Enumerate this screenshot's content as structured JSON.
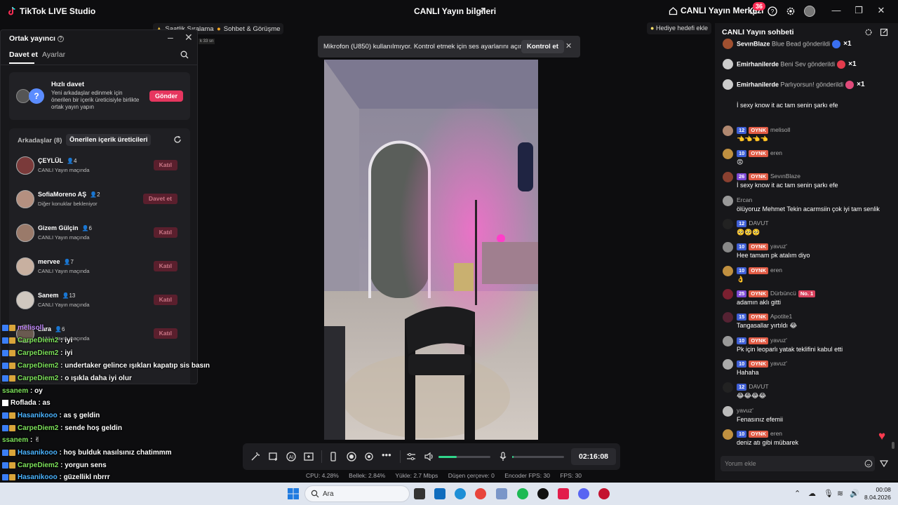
{
  "titlebar": {
    "app_title": "TikTok LIVE Studio",
    "center_title": "CANLI Yayın bilgileri",
    "live_center": "CANLI Yayın Merkezi",
    "notif_count": "36"
  },
  "chips": {
    "ranking": "Saatlik Sıralama",
    "chat_meet": "Sohbet & Görüşme",
    "gift_goal": "Hediye hedefi ekle",
    "distance": "k 33 sn"
  },
  "cohost": {
    "title": "Ortak yayıncı",
    "tab_invite": "Davet et",
    "tab_settings": "Ayarlar",
    "quick_title": "Hızlı davet",
    "quick_desc": "Yeni arkadaşlar edinmek için önerilen bir içerik üreticisiyle birlikte ortak yayın yapın",
    "quick_btn": "Gönder",
    "friends_tab": "Arkadaşlar (8)",
    "suggested_tab": "Önerilen içerik üreticileri",
    "friends": [
      {
        "name": "ÇEYLÜL",
        "count": "4",
        "status": "CANLI Yayın maçında",
        "btn": "Katıl"
      },
      {
        "name": "SofiaMoreno AŞ",
        "count": "2",
        "status": "Diğer konuklar bekleniyor",
        "btn": "Davet et"
      },
      {
        "name": "Gizem Gülçin",
        "count": "6",
        "status": "CANLI Yayın maçında",
        "btn": "Katıl"
      },
      {
        "name": "mervee",
        "count": "7",
        "status": "CANLI Yayın maçında",
        "btn": "Katıl"
      },
      {
        "name": "Sanem",
        "count": "13",
        "status": "CANLI Yayın maçında",
        "btn": "Katıl"
      },
      {
        "name": "Lara",
        "count": "6",
        "status": "CANLI Yayın maçında",
        "btn": "Katıl"
      }
    ]
  },
  "overlay_chat": [
    {
      "user": "melisoll",
      "text": "",
      "style": "purple"
    },
    {
      "user": "CarpeDiem2",
      "text": ": iyi",
      "style": "green"
    },
    {
      "user": "CarpeDiem2",
      "text": ": iyi",
      "style": "green"
    },
    {
      "user": "CarpeDiem2",
      "text": ": undertaker gelince ışıkları kapatıp sis basın",
      "style": "green"
    },
    {
      "user": "CarpeDiem2",
      "text": ": o ışıkla daha iyi olur",
      "style": "green"
    },
    {
      "user": "ssanem",
      "text": ": oy",
      "style": "plain-green"
    },
    {
      "user": "Roflada",
      "text": ": as",
      "style": "white"
    },
    {
      "user": "Hasanikooo",
      "text": ": as ş geldin",
      "style": "blue"
    },
    {
      "user": "CarpeDiem2",
      "text": ": sende hoş geldin",
      "style": "green"
    },
    {
      "user": "ssanem",
      "text": ": ✌",
      "style": "plain-green"
    },
    {
      "user": "Hasanikooo",
      "text": ": hoş bulduk nasılsınız chatimmm",
      "style": "blue"
    },
    {
      "user": "CarpeDiem2",
      "text": ": yorgun sens",
      "style": "green"
    },
    {
      "user": "Hasanikooo",
      "text": ": güzellikl nbrrr",
      "style": "blue"
    }
  ],
  "mic_toast": {
    "text": "Mikrofon (U850) kullanılmıyor. Kontrol etmek için ses ayarlarını açın.",
    "btn": "Kontrol et"
  },
  "controls": {
    "timer": "02:16:08",
    "volume_level": 0.35,
    "mic_level": 0.03
  },
  "stats": {
    "cpu": "CPU: 4.28%",
    "mem": "Bellek: 2.84%",
    "upload": "Yükle: 2.7 Mbps",
    "dropped": "Düşen çerçeve: 0",
    "encoder": "Encoder FPS: 30",
    "fps": "FPS: 30"
  },
  "right_chat": {
    "title": "CANLI Yayın sohbeti",
    "gifts": [
      {
        "user": "SevınBlaze",
        "text": "Blue Bead gönderildi",
        "mult": "×1",
        "color": "#3a6ff0"
      },
      {
        "user": "Emirhanilerde",
        "text": "Beni Sev gönderildi",
        "mult": "×1",
        "color": "#e33b4c"
      },
      {
        "user": "Emirhanilerde",
        "text": "Parlıyorsun! gönderildi",
        "mult": "×1",
        "color": "#e04a7a"
      }
    ],
    "messages": [
      {
        "level": "",
        "oynk": false,
        "user": "",
        "body": "İ sexy know it ac tam senin şarkı efe",
        "nohead": true
      },
      {
        "level": "12",
        "oynk": true,
        "user": "melisoll",
        "body": "👈👈👈👈"
      },
      {
        "level": "10",
        "oynk": true,
        "user": "eren",
        "body": "😡"
      },
      {
        "level": "26",
        "oynk": true,
        "user": "SevınBlaze",
        "body": "İ sexy know it ac tam senin şarkı efe",
        "purple": true
      },
      {
        "level": "",
        "oynk": false,
        "user": "Ercan",
        "body": "ölüyoruz Mehmet Tekin acarmsiin çok iyi tam senlik"
      },
      {
        "level": "12",
        "oynk": false,
        "user": "DAVUT",
        "body": "🥺🥺🥺"
      },
      {
        "level": "10",
        "oynk": true,
        "user": "yavuz'",
        "body": "Hee tamam pk atalım diyo"
      },
      {
        "level": "10",
        "oynk": true,
        "user": "eren",
        "body": "👌"
      },
      {
        "level": "25",
        "oynk": true,
        "user": "Dürbüncü",
        "body": "adamın aklı gitti",
        "purple": true,
        "no1": "No. 1"
      },
      {
        "level": "15",
        "oynk": true,
        "user": "Apotite1",
        "body": "Tangasallar yırtıldı 😂"
      },
      {
        "level": "10",
        "oynk": true,
        "user": "yavuz'",
        "body": "Pk için leoparlı yatak teklifini kabul etti"
      },
      {
        "level": "10",
        "oynk": true,
        "user": "yavuz'",
        "body": "Hahaha"
      },
      {
        "level": "12",
        "oynk": false,
        "user": "DAVUT",
        "body": "😂😂😂😂"
      },
      {
        "level": "",
        "oynk": false,
        "user": "yavuz'",
        "body": "Fenasınız efemii"
      },
      {
        "level": "10",
        "oynk": true,
        "user": "eren",
        "body": "deniz atı gibi mübarek"
      }
    ],
    "oynk_label": "OYNK",
    "comment_placeholder": "Yorum ekle"
  },
  "taskbar": {
    "search": "Ara",
    "time": "00:08",
    "date": "8.04.2026"
  }
}
